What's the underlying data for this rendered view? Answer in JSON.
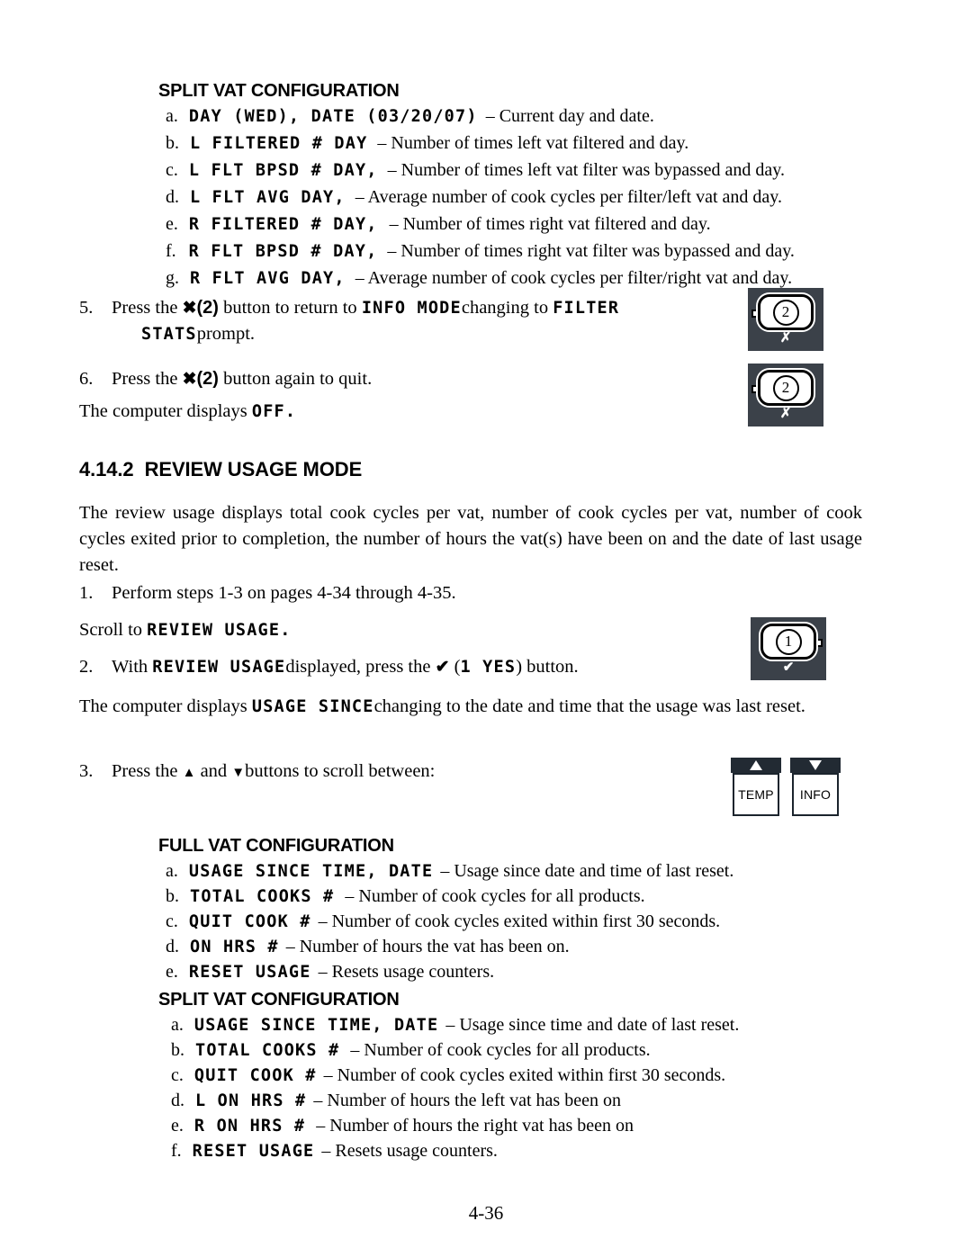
{
  "page": {
    "number": "4-36"
  },
  "top_section": {
    "heading": "SPLIT VAT CONFIGURATION",
    "items": [
      {
        "letter": "a.",
        "lcd": "DAY (WED), DATE (03/20/07)",
        "desc": "– Current day and date."
      },
      {
        "letter": "b.",
        "lcd": "L FILTERED # DAY",
        "desc": "– Number of times left vat filtered and day."
      },
      {
        "letter": "c.",
        "lcd": "L FLT BPSD # DAY,",
        "desc": "– Number of times left vat filter was bypassed and day."
      },
      {
        "letter": "d.",
        "lcd": "L FLT AVG DAY,",
        "desc": "– Average number of cook cycles per filter/left vat and day."
      },
      {
        "letter": "e.",
        "lcd": "R FILTERED # DAY,",
        "desc": "– Number of times right vat filtered and day."
      },
      {
        "letter": "f.",
        "lcd": "R FLT BPSD # DAY,",
        "desc": "– Number of times right vat filter was bypassed and day."
      },
      {
        "letter": "g.",
        "lcd": "R FLT AVG DAY,",
        "desc": "– Average number of cook cycles per filter/right vat and day."
      }
    ]
  },
  "step5": {
    "num": "5.",
    "text_a": "Press the",
    "glyph": "✖",
    "paren": "(2)",
    "text_b": "button to return to",
    "lcd_a": "INFO MODE",
    "text_c": "changing to",
    "lcd_b": "FILTER",
    "lcd_c": "STATS",
    "text_d": "prompt."
  },
  "step6": {
    "num": "6.",
    "text_a": "Press the",
    "glyph": "✖",
    "paren": "(2)",
    "text_b": "button again to quit."
  },
  "off_line": {
    "text_a": "The computer displays",
    "lcd": "OFF.",
    "text_b": ""
  },
  "section": {
    "number": "4.14.2",
    "title": "REVIEW USAGE MODE",
    "intro": "The review usage displays total cook cycles per vat, number of cook cycles per vat, number of cook cycles exited prior to completion, the number of hours the vat(s) have been on and the date of last usage reset."
  },
  "step1": {
    "num": "1.",
    "text": "Perform steps 1-3 on pages 4-34 through 4-35."
  },
  "scroll_line": {
    "text_a": "Scroll to",
    "lcd": "REVIEW USAGE.",
    "text_b": ""
  },
  "step2": {
    "num": "2.",
    "text_a": "With",
    "lcd_a": "REVIEW USAGE",
    "text_b": "displayed, press the",
    "glyph": "✔",
    "paren_open": "(",
    "lcd_b": "1 YES",
    "paren_close": ")",
    "text_c": "button."
  },
  "usage_since_line": {
    "text_a": "The computer displays",
    "lcd": "USAGE SINCE",
    "text_b": "changing to the date and time that the usage was last reset."
  },
  "step3": {
    "num": "3.",
    "text_a": "Press the",
    "up_arrow": "▲",
    "text_b": "and",
    "down_arrow": "▼",
    "text_c": "buttons to scroll between:"
  },
  "full_vat_section": {
    "heading": "FULL VAT CONFIGURATION",
    "items": [
      {
        "letter": "a.",
        "lcd": "USAGE SINCE TIME, DATE",
        "desc": "– Usage since date and time of last reset."
      },
      {
        "letter": "b.",
        "lcd": "TOTAL COOKS #",
        "desc": "– Number of cook cycles for all products."
      },
      {
        "letter": "c.",
        "lcd": "QUIT COOK #",
        "desc": "– Number of cook cycles exited within first 30 seconds."
      },
      {
        "letter": "d.",
        "lcd": "ON HRS #",
        "desc": "– Number of hours the vat has been on."
      },
      {
        "letter": "e.",
        "lcd": "RESET USAGE",
        "desc": "– Resets usage counters."
      }
    ]
  },
  "split_vat_section": {
    "heading": "SPLIT VAT CONFIGURATION",
    "items": [
      {
        "letter": "a.",
        "lcd": "USAGE SINCE TIME, DATE",
        "desc": "– Usage since time and date of last reset."
      },
      {
        "letter": "b.",
        "lcd": "TOTAL COOKS #",
        "desc": "– Number of cook cycles for all products."
      },
      {
        "letter": "c.",
        "lcd": "QUIT COOK #",
        "desc": "– Number of cook cycles exited within first 30 seconds."
      },
      {
        "letter": "d.",
        "lcd": "L ON HRS #",
        "desc": "– Number of hours the left vat has been on"
      },
      {
        "letter": "e.",
        "lcd": "R ON HRS #",
        "desc": "– Number of hours the right vat has been on"
      },
      {
        "letter": "f.",
        "lcd": "RESET USAGE",
        "desc": "– Resets usage counters."
      }
    ]
  },
  "buttons": {
    "key2_a": {
      "digit": "2",
      "sub": "✗"
    },
    "key2_b": {
      "digit": "2",
      "sub": "✗"
    },
    "key1": {
      "digit": "1",
      "sub": "✔"
    },
    "temp": {
      "label": "TEMP",
      "arrow": "up"
    },
    "info": {
      "label": "INFO",
      "arrow": "down"
    }
  },
  "colors": {
    "key_bg": "#3b4149",
    "arrow_hdr": "#222a33",
    "text": "#000000",
    "page_bg": "#ffffff"
  }
}
